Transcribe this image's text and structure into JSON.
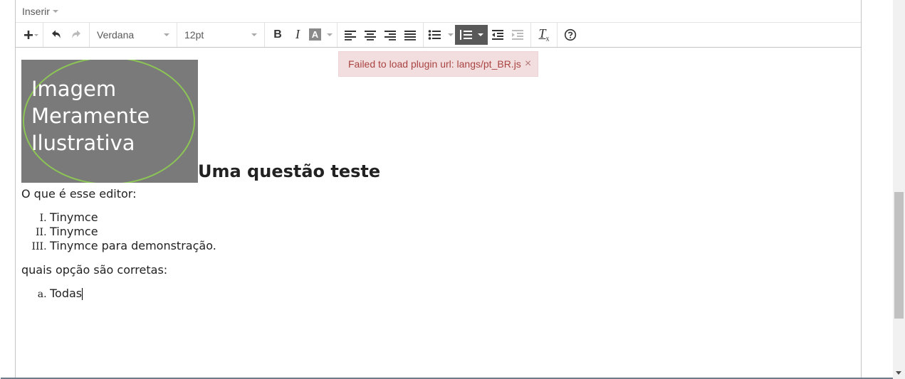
{
  "menubar": {
    "insert_label": "Inserir"
  },
  "toolbar": {
    "font_family": "Verdana",
    "font_size": "12pt",
    "bold_label": "B",
    "italic_label": "I",
    "text_color_label": "A",
    "clear_format_label": "Tx"
  },
  "notification": {
    "message": "Failed to load plugin url: langs/pt_BR.js",
    "close": "×"
  },
  "content": {
    "image_text": "Imagem\nMeramente\nIlustrativa",
    "heading": "Uma questão teste",
    "question": "O que é esse editor:",
    "roman_items": [
      "Tinymce",
      "Tinymce",
      "Tinymce para demonstração."
    ],
    "prompt": "quais opção são corretas:",
    "alpha_items": [
      "Todas"
    ]
  },
  "colors": {
    "active_button_bg": "#595959",
    "notification_bg": "#f2dede",
    "notification_text": "#a94442"
  }
}
